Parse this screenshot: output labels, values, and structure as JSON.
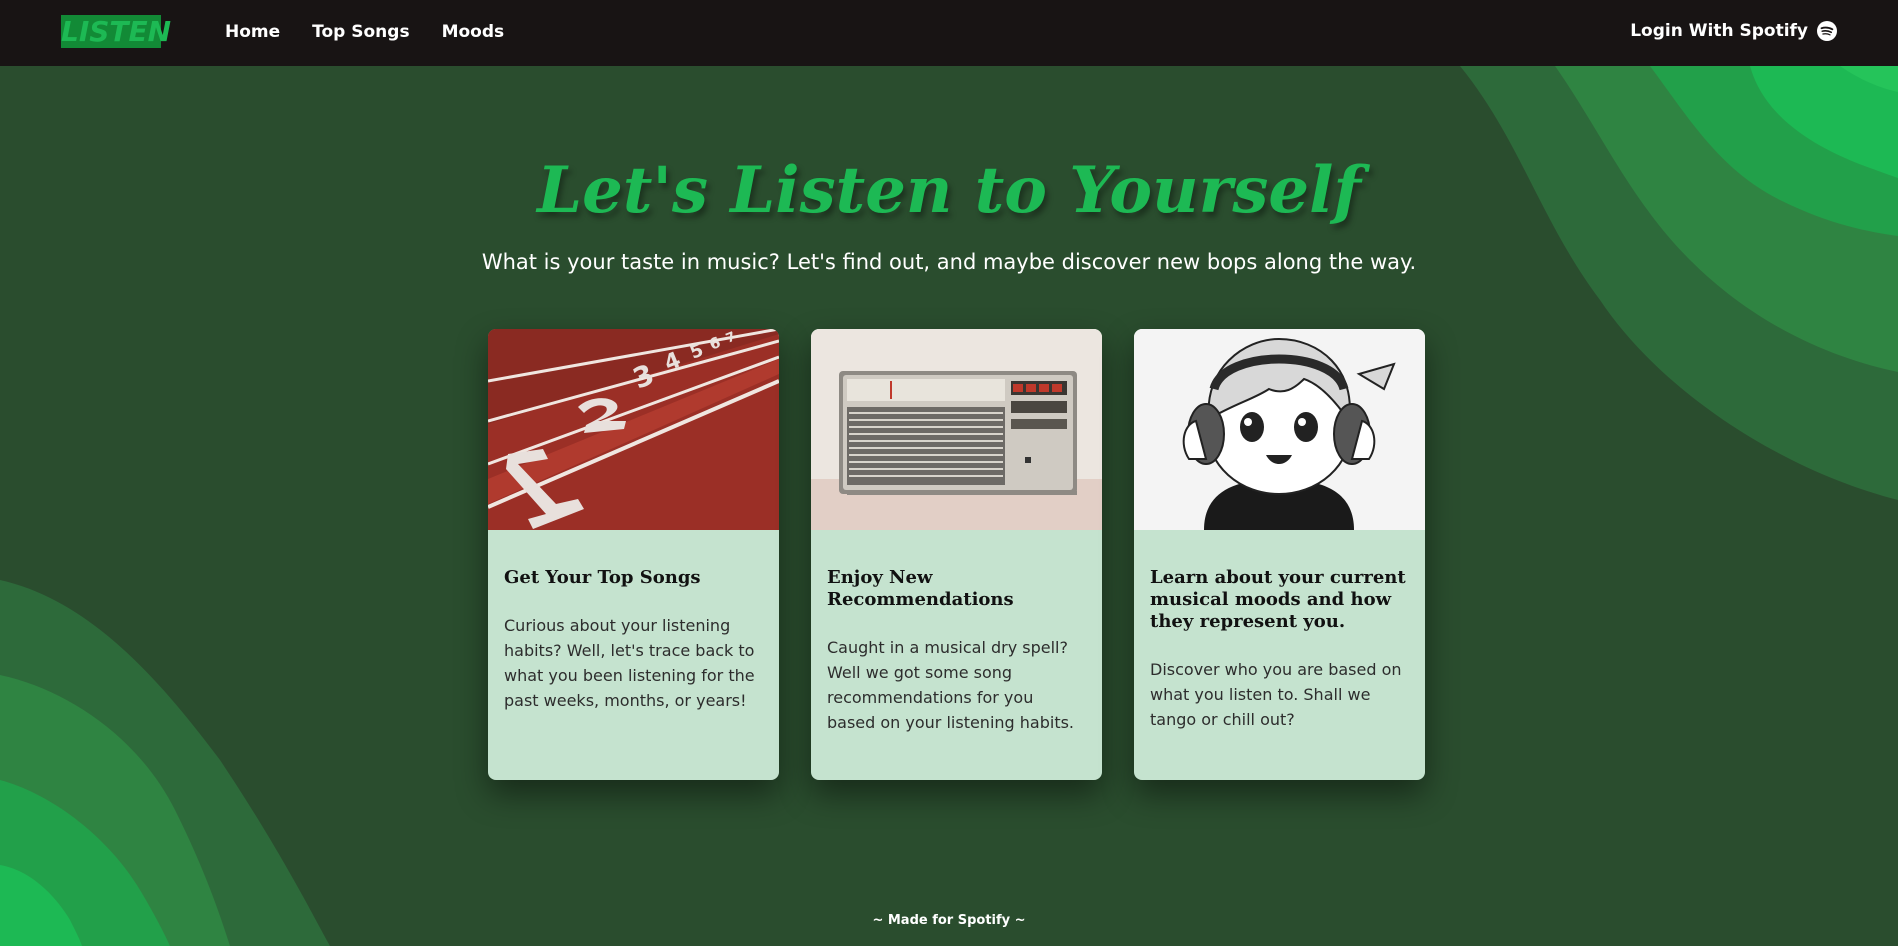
{
  "brand": {
    "logo_text": "LISTEN"
  },
  "nav": {
    "items": [
      "Home",
      "Top Songs",
      "Moods"
    ]
  },
  "auth": {
    "login_label": "Login With Spotify",
    "icon": "spotify-icon"
  },
  "hero": {
    "title": "Let's Listen to Yourself",
    "subtitle": "What is your taste in music? Let's find out, and maybe discover new bops along the way."
  },
  "cards": [
    {
      "title": "Get Your Top Songs",
      "text": "Curious about your listening habits? Well, let's trace back to what you been listening for the past weeks, months, or years!"
    },
    {
      "title": "Enjoy New Recommendations",
      "text": "Caught in a musical dry spell? Well we got some song recommendations for you based on your listening habits."
    },
    {
      "title": "Learn about your current musical moods and how they represent you.",
      "text": "Discover who you are based on what you listen to. Shall we tango or chill out?"
    }
  ],
  "footer": {
    "text": "~ Made for Spotify ~"
  },
  "colors": {
    "accent": "#1db954",
    "navbar": "#181414",
    "background": "#2a4d2e",
    "card": "#c5e3cf"
  }
}
